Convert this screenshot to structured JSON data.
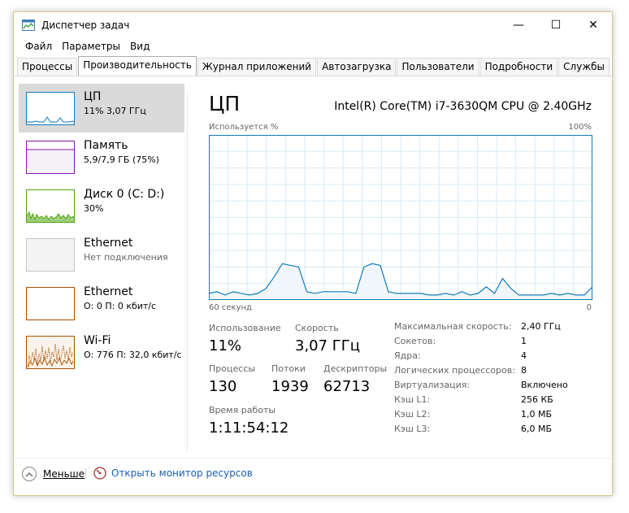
{
  "window": {
    "title": "Диспетчер задач",
    "minimize_glyph": "—",
    "maximize_glyph": "☐",
    "close_glyph": "✕"
  },
  "menu": [
    "Файл",
    "Параметры",
    "Вид"
  ],
  "tabs": [
    {
      "label": "Процессы",
      "active": false
    },
    {
      "label": "Производительность",
      "active": true
    },
    {
      "label": "Журнал приложений",
      "active": false
    },
    {
      "label": "Автозагрузка",
      "active": false
    },
    {
      "label": "Пользователи",
      "active": false
    },
    {
      "label": "Подробности",
      "active": false
    },
    {
      "label": "Службы",
      "active": false
    }
  ],
  "sidebar": {
    "items": [
      {
        "title": "ЦП",
        "sub": "11%  3,07 ГГц",
        "color": "#117dbb",
        "fill": "#f1f6fa"
      },
      {
        "title": "Память",
        "sub": "5,9/7,9 ГБ (75%)",
        "color": "#8b12ae",
        "fill": "#f4f2f4"
      },
      {
        "title": "Диск 0 (C: D:)",
        "sub": "30%",
        "color": "#4da60c",
        "fill": "#eff7e8"
      },
      {
        "title": "Ethernet",
        "sub": "Нет подключения",
        "color": "#c5c5c5",
        "fill": "#f4f4f4"
      },
      {
        "title": "Ethernet",
        "sub": "О: 0 П: 0 кбит/с",
        "color": "#a74f01",
        "fill": "#ffffff"
      },
      {
        "title": "Wi-Fi",
        "sub": "О: 776 П: 32,0 кбит/с",
        "color": "#a74f01",
        "fill": "#fcf3ea"
      }
    ]
  },
  "main": {
    "title": "ЦП",
    "model": "Intel(R) Core(TM) i7-3630QM CPU @ 2.40GHz",
    "graph": {
      "top_left": "Используется %",
      "top_right": "100%",
      "bottom_left": "60 секунд",
      "bottom_right": "0",
      "line_color": "#117dbb",
      "fill_color": "#f1f6fa",
      "grid_color": "#d9eaf4",
      "usage_percent": [
        4,
        5,
        3,
        5,
        4,
        3,
        4,
        7,
        14,
        22,
        21,
        20,
        5,
        4,
        5,
        5,
        5,
        5,
        4,
        20,
        22,
        21,
        5,
        4,
        4,
        4,
        4,
        3,
        3,
        4,
        3,
        5,
        3,
        4,
        8,
        4,
        13,
        7,
        3,
        3,
        3,
        3,
        4,
        3,
        4,
        3,
        3,
        8
      ]
    },
    "stats": {
      "utilization_label": "Использование",
      "utilization_value": "11%",
      "speed_label": "Скорость",
      "speed_value": "3,07 ГГц",
      "processes_label": "Процессы",
      "processes_value": "130",
      "threads_label": "Потоки",
      "threads_value": "1939",
      "handles_label": "Дескрипторы",
      "handles_value": "62713",
      "uptime_label": "Время работы",
      "uptime_value": "1:11:54:12"
    },
    "specs": [
      {
        "key": "Максимальная скорость:",
        "value": "2,40 ГГц"
      },
      {
        "key": "Сокетов:",
        "value": "1"
      },
      {
        "key": "Ядра:",
        "value": "4"
      },
      {
        "key": "Логических процессоров:",
        "value": "8"
      },
      {
        "key": "Виртуализация:",
        "value": "Включено"
      },
      {
        "key": "Кэш L1:",
        "value": "256 КБ"
      },
      {
        "key": "Кэш L2:",
        "value": "1,0 МБ"
      },
      {
        "key": "Кэш L3:",
        "value": "6,0 МБ"
      }
    ]
  },
  "footer": {
    "less_label": "Меньше",
    "monitor_label": "Открыть монитор ресурсов"
  }
}
